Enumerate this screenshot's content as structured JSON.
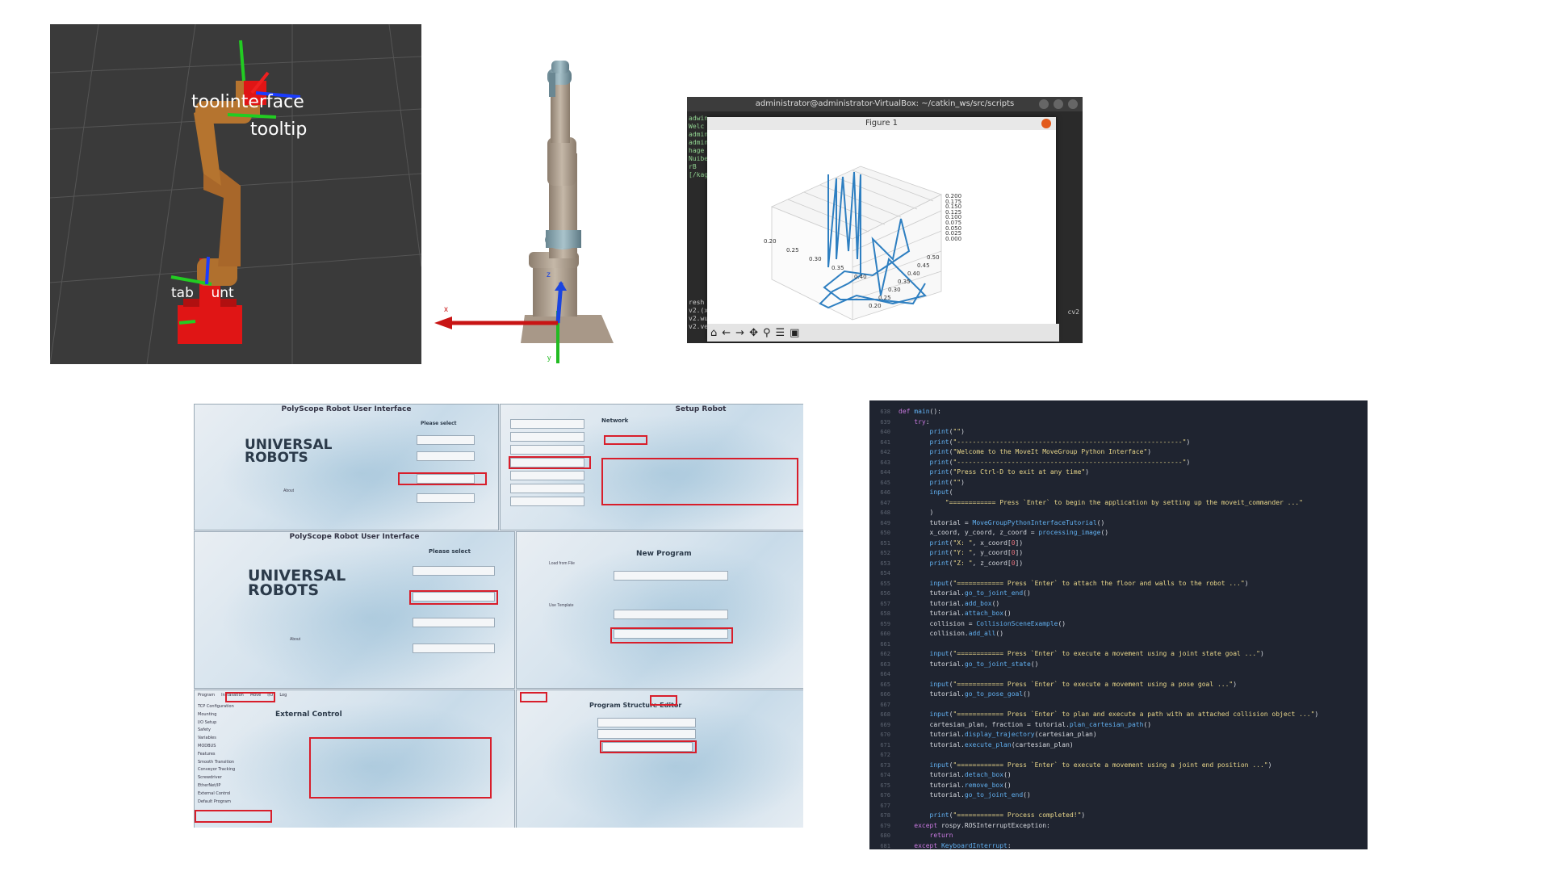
{
  "rviz": {
    "labels": {
      "toolinterface": "toolinterface",
      "tooltip": "tooltip",
      "tablemount": "tab    unt"
    }
  },
  "model": {
    "axis_x": "x",
    "axis_y": "y",
    "axis_z": "z"
  },
  "plot_window": {
    "terminal_title": "administrator@administrator-VirtualBox: ~/catkin_ws/src/scripts",
    "terminal_lines_top": [
      "adwin",
      "Welc",
      "admin",
      "admin",
      "hage",
      "Nuiber",
      "rB",
      "[/kaga"
    ],
    "terminal_lines_bottom": [
      "resh",
      "v2.(x",
      "v2.wu",
      "v2.ve"
    ],
    "terminal_right": "cv2",
    "figure_title": "Figure 1",
    "z_ticks": [
      "0.200",
      "0.175",
      "0.150",
      "0.125",
      "0.100",
      "0.075",
      "0.050",
      "0.025",
      "0.000"
    ],
    "x_ticks": [
      "0.20",
      "0.25",
      "0.30",
      "0.35",
      "0.40"
    ],
    "y_ticks": [
      "0.20",
      "0.25",
      "0.30",
      "0.35",
      "0.40",
      "0.45",
      "0.50"
    ],
    "toolbar": [
      "home-icon",
      "back-icon",
      "forward-icon",
      "pan-icon",
      "zoom-icon",
      "configure-icon",
      "save-icon"
    ]
  },
  "polyscope": {
    "tile1_header": "PolyScope Robot User Interface",
    "tile1_logo_line1": "UNIVERSAL",
    "tile1_logo_line2": "ROBOTS",
    "tile1_prompt": "Please select",
    "tile1_about": "About",
    "tile2_header": "Setup Robot",
    "tile2_section": "Network",
    "tile3_header": "PolyScope Robot User Interface",
    "tile3_logo_line1": "UNIVERSAL",
    "tile3_logo_line2": "ROBOTS",
    "tile3_prompt": "Please select",
    "tile3_about": "About",
    "tile4_title": "New Program",
    "tile4_load": "Load from File",
    "tile4_template": "Use Template",
    "tile5_title": "External Control",
    "tile5_tabs": [
      "Program",
      "Installation",
      "Move",
      "I/O",
      "Log"
    ],
    "tile5_menu": [
      "TCP Configuration",
      "Mounting",
      "I/O Setup",
      "Safety",
      "Variables",
      "MODBUS",
      "Features",
      "Smooth Transition",
      "Conveyor Tracking",
      "Screwdriver",
      "EtherNet/IP",
      "External Control",
      "Default Program"
    ],
    "tile6_title": "Program Structure Editor"
  },
  "code": {
    "start_line": 638,
    "lines": [
      [
        [
          "kw",
          "def "
        ],
        [
          "fn",
          "main"
        ],
        [
          "tx",
          "():"
        ]
      ],
      [
        [
          "tx",
          "    "
        ],
        [
          "kw",
          "try"
        ],
        [
          "tx",
          ":"
        ]
      ],
      [
        [
          "tx",
          "        "
        ],
        [
          "fn",
          "print"
        ],
        [
          "tx",
          "("
        ],
        [
          "st",
          "\"\""
        ],
        [
          "tx",
          ")"
        ]
      ],
      [
        [
          "tx",
          "        "
        ],
        [
          "fn",
          "print"
        ],
        [
          "tx",
          "("
        ],
        [
          "st",
          "\"----------------------------------------------------------\""
        ],
        [
          "tx",
          ")"
        ]
      ],
      [
        [
          "tx",
          "        "
        ],
        [
          "fn",
          "print"
        ],
        [
          "tx",
          "("
        ],
        [
          "st",
          "\"Welcome to the MoveIt MoveGroup Python Interface\""
        ],
        [
          "tx",
          ")"
        ]
      ],
      [
        [
          "tx",
          "        "
        ],
        [
          "fn",
          "print"
        ],
        [
          "tx",
          "("
        ],
        [
          "st",
          "\"----------------------------------------------------------\""
        ],
        [
          "tx",
          ")"
        ]
      ],
      [
        [
          "tx",
          "        "
        ],
        [
          "fn",
          "print"
        ],
        [
          "tx",
          "("
        ],
        [
          "st",
          "\"Press Ctrl-D to exit at any time\""
        ],
        [
          "tx",
          ")"
        ]
      ],
      [
        [
          "tx",
          "        "
        ],
        [
          "fn",
          "print"
        ],
        [
          "tx",
          "("
        ],
        [
          "st",
          "\"\""
        ],
        [
          "tx",
          ")"
        ]
      ],
      [
        [
          "tx",
          "        "
        ],
        [
          "fn",
          "input"
        ],
        [
          "tx",
          "("
        ]
      ],
      [
        [
          "tx",
          "            "
        ],
        [
          "st",
          "\"============ Press `Enter` to begin the application by setting up the moveit_commander ...\""
        ]
      ],
      [
        [
          "tx",
          "        )"
        ]
      ],
      [
        [
          "tx",
          "        tutorial = "
        ],
        [
          "fn",
          "MoveGroupPythonInterfaceTutorial"
        ],
        [
          "tx",
          "()"
        ]
      ],
      [
        [
          "tx",
          "        x_coord, y_coord, z_coord = "
        ],
        [
          "fn",
          "processing_image"
        ],
        [
          "tx",
          "()"
        ]
      ],
      [
        [
          "tx",
          "        "
        ],
        [
          "fn",
          "print"
        ],
        [
          "tx",
          "("
        ],
        [
          "st",
          "\"X: \""
        ],
        [
          "tx",
          ", x_coord["
        ],
        [
          "nm",
          "0"
        ],
        [
          "tx",
          "])"
        ]
      ],
      [
        [
          "tx",
          "        "
        ],
        [
          "fn",
          "print"
        ],
        [
          "tx",
          "("
        ],
        [
          "st",
          "\"Y: \""
        ],
        [
          "tx",
          ", y_coord["
        ],
        [
          "nm",
          "0"
        ],
        [
          "tx",
          "])"
        ]
      ],
      [
        [
          "tx",
          "        "
        ],
        [
          "fn",
          "print"
        ],
        [
          "tx",
          "("
        ],
        [
          "st",
          "\"Z: \""
        ],
        [
          "tx",
          ", z_coord["
        ],
        [
          "nm",
          "0"
        ],
        [
          "tx",
          "])"
        ]
      ],
      [
        [
          "tx",
          ""
        ]
      ],
      [
        [
          "tx",
          "        "
        ],
        [
          "fn",
          "input"
        ],
        [
          "tx",
          "("
        ],
        [
          "st",
          "\"============ Press `Enter` to attach the floor and walls to the robot ...\""
        ],
        [
          "tx",
          ")"
        ]
      ],
      [
        [
          "tx",
          "        tutorial."
        ],
        [
          "fn",
          "go_to_joint_end"
        ],
        [
          "tx",
          "()"
        ]
      ],
      [
        [
          "tx",
          "        tutorial."
        ],
        [
          "fn",
          "add_box"
        ],
        [
          "tx",
          "()"
        ]
      ],
      [
        [
          "tx",
          "        tutorial."
        ],
        [
          "fn",
          "attach_box"
        ],
        [
          "tx",
          "()"
        ]
      ],
      [
        [
          "tx",
          "        collision = "
        ],
        [
          "fn",
          "CollisionSceneExample"
        ],
        [
          "tx",
          "()"
        ]
      ],
      [
        [
          "tx",
          "        collision."
        ],
        [
          "fn",
          "add_all"
        ],
        [
          "tx",
          "()"
        ]
      ],
      [
        [
          "tx",
          ""
        ]
      ],
      [
        [
          "tx",
          "        "
        ],
        [
          "fn",
          "input"
        ],
        [
          "tx",
          "("
        ],
        [
          "st",
          "\"============ Press `Enter` to execute a movement using a joint state goal ...\""
        ],
        [
          "tx",
          ")"
        ]
      ],
      [
        [
          "tx",
          "        tutorial."
        ],
        [
          "fn",
          "go_to_joint_state"
        ],
        [
          "tx",
          "()"
        ]
      ],
      [
        [
          "tx",
          ""
        ]
      ],
      [
        [
          "tx",
          "        "
        ],
        [
          "fn",
          "input"
        ],
        [
          "tx",
          "("
        ],
        [
          "st",
          "\"============ Press `Enter` to execute a movement using a pose goal ...\""
        ],
        [
          "tx",
          ")"
        ]
      ],
      [
        [
          "tx",
          "        tutorial."
        ],
        [
          "fn",
          "go_to_pose_goal"
        ],
        [
          "tx",
          "()"
        ]
      ],
      [
        [
          "tx",
          ""
        ]
      ],
      [
        [
          "tx",
          "        "
        ],
        [
          "fn",
          "input"
        ],
        [
          "tx",
          "("
        ],
        [
          "st",
          "\"============ Press `Enter` to plan and execute a path with an attached collision object ...\""
        ],
        [
          "tx",
          ")"
        ]
      ],
      [
        [
          "tx",
          "        cartesian_plan, fraction = tutorial."
        ],
        [
          "fn",
          "plan_cartesian_path"
        ],
        [
          "tx",
          "()"
        ]
      ],
      [
        [
          "tx",
          "        tutorial."
        ],
        [
          "fn",
          "display_trajectory"
        ],
        [
          "tx",
          "(cartesian_plan)"
        ]
      ],
      [
        [
          "tx",
          "        tutorial."
        ],
        [
          "fn",
          "execute_plan"
        ],
        [
          "tx",
          "(cartesian_plan)"
        ]
      ],
      [
        [
          "tx",
          ""
        ]
      ],
      [
        [
          "tx",
          "        "
        ],
        [
          "fn",
          "input"
        ],
        [
          "tx",
          "("
        ],
        [
          "st",
          "\"============ Press `Enter` to execute a movement using a joint end position ...\""
        ],
        [
          "tx",
          ")"
        ]
      ],
      [
        [
          "tx",
          "        tutorial."
        ],
        [
          "fn",
          "detach_box"
        ],
        [
          "tx",
          "()"
        ]
      ],
      [
        [
          "tx",
          "        tutorial."
        ],
        [
          "fn",
          "remove_box"
        ],
        [
          "tx",
          "()"
        ]
      ],
      [
        [
          "tx",
          "        tutorial."
        ],
        [
          "fn",
          "go_to_joint_end"
        ],
        [
          "tx",
          "()"
        ]
      ],
      [
        [
          "tx",
          ""
        ]
      ],
      [
        [
          "tx",
          "        "
        ],
        [
          "fn",
          "print"
        ],
        [
          "tx",
          "("
        ],
        [
          "st",
          "\"============ Process completed!\""
        ],
        [
          "tx",
          ")"
        ]
      ],
      [
        [
          "tx",
          "    "
        ],
        [
          "kw",
          "except "
        ],
        [
          "tx",
          "rospy.ROSInterruptException:"
        ]
      ],
      [
        [
          "tx",
          "        "
        ],
        [
          "kw",
          "return"
        ]
      ],
      [
        [
          "tx",
          "    "
        ],
        [
          "kw",
          "except "
        ],
        [
          "fn",
          "KeyboardInterrupt"
        ],
        [
          "tx",
          ":"
        ]
      ]
    ]
  }
}
